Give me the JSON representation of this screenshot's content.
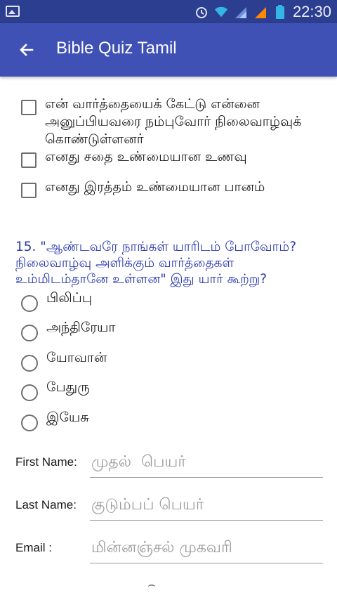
{
  "status_bar": {
    "time": "22:30",
    "icons": [
      "image-icon",
      "alarm-icon",
      "wifi-icon",
      "signal-icon",
      "signal-icon-2",
      "battery-icon"
    ]
  },
  "app_bar": {
    "title": "Bible Quiz Tamil",
    "back_icon": "arrow-left-icon"
  },
  "checkbox_options": [
    {
      "label": "என் வார்த்தையைக் கேட்டு என்னை அனுப்பியவரை நம்புவோர் நிலைவாழ்வுக் கொண்டுள்ளனர்",
      "checked": false
    },
    {
      "label": "எனது சதை உண்மையான உணவு",
      "checked": false
    },
    {
      "label": "எனது இரத்தம் உண்மையான பானம்",
      "checked": false
    }
  ],
  "question": {
    "text": "15. \"ஆண்டவரே நாங்கள் யாரிடம் போவோம்? நிலைவாழ்வு அளிக்கும் வார்த்தைகள் உம்மிடம்தானே உள்ளன\" இது யார் கூற்று?"
  },
  "radio_options": [
    {
      "label": "பிலிப்பு",
      "selected": false
    },
    {
      "label": "அந்திரேயா",
      "selected": false
    },
    {
      "label": "யோவான்",
      "selected": false
    },
    {
      "label": "பேதுரு",
      "selected": false
    },
    {
      "label": "இயேசு",
      "selected": false
    }
  ],
  "form": {
    "first_name": {
      "label": "First Name:",
      "placeholder": "முதல்  பெயர்",
      "value": ""
    },
    "last_name": {
      "label": "Last Name:",
      "placeholder": "குடும்பப் பெயர்",
      "value": ""
    },
    "email": {
      "label": "Email :",
      "placeholder": "மின்னஞ்சல் முகவரி",
      "value": ""
    }
  },
  "colors": {
    "status_bar": "#2c3e8f",
    "app_bar": "#3f51b5",
    "question_text": "#2a3bb0"
  }
}
